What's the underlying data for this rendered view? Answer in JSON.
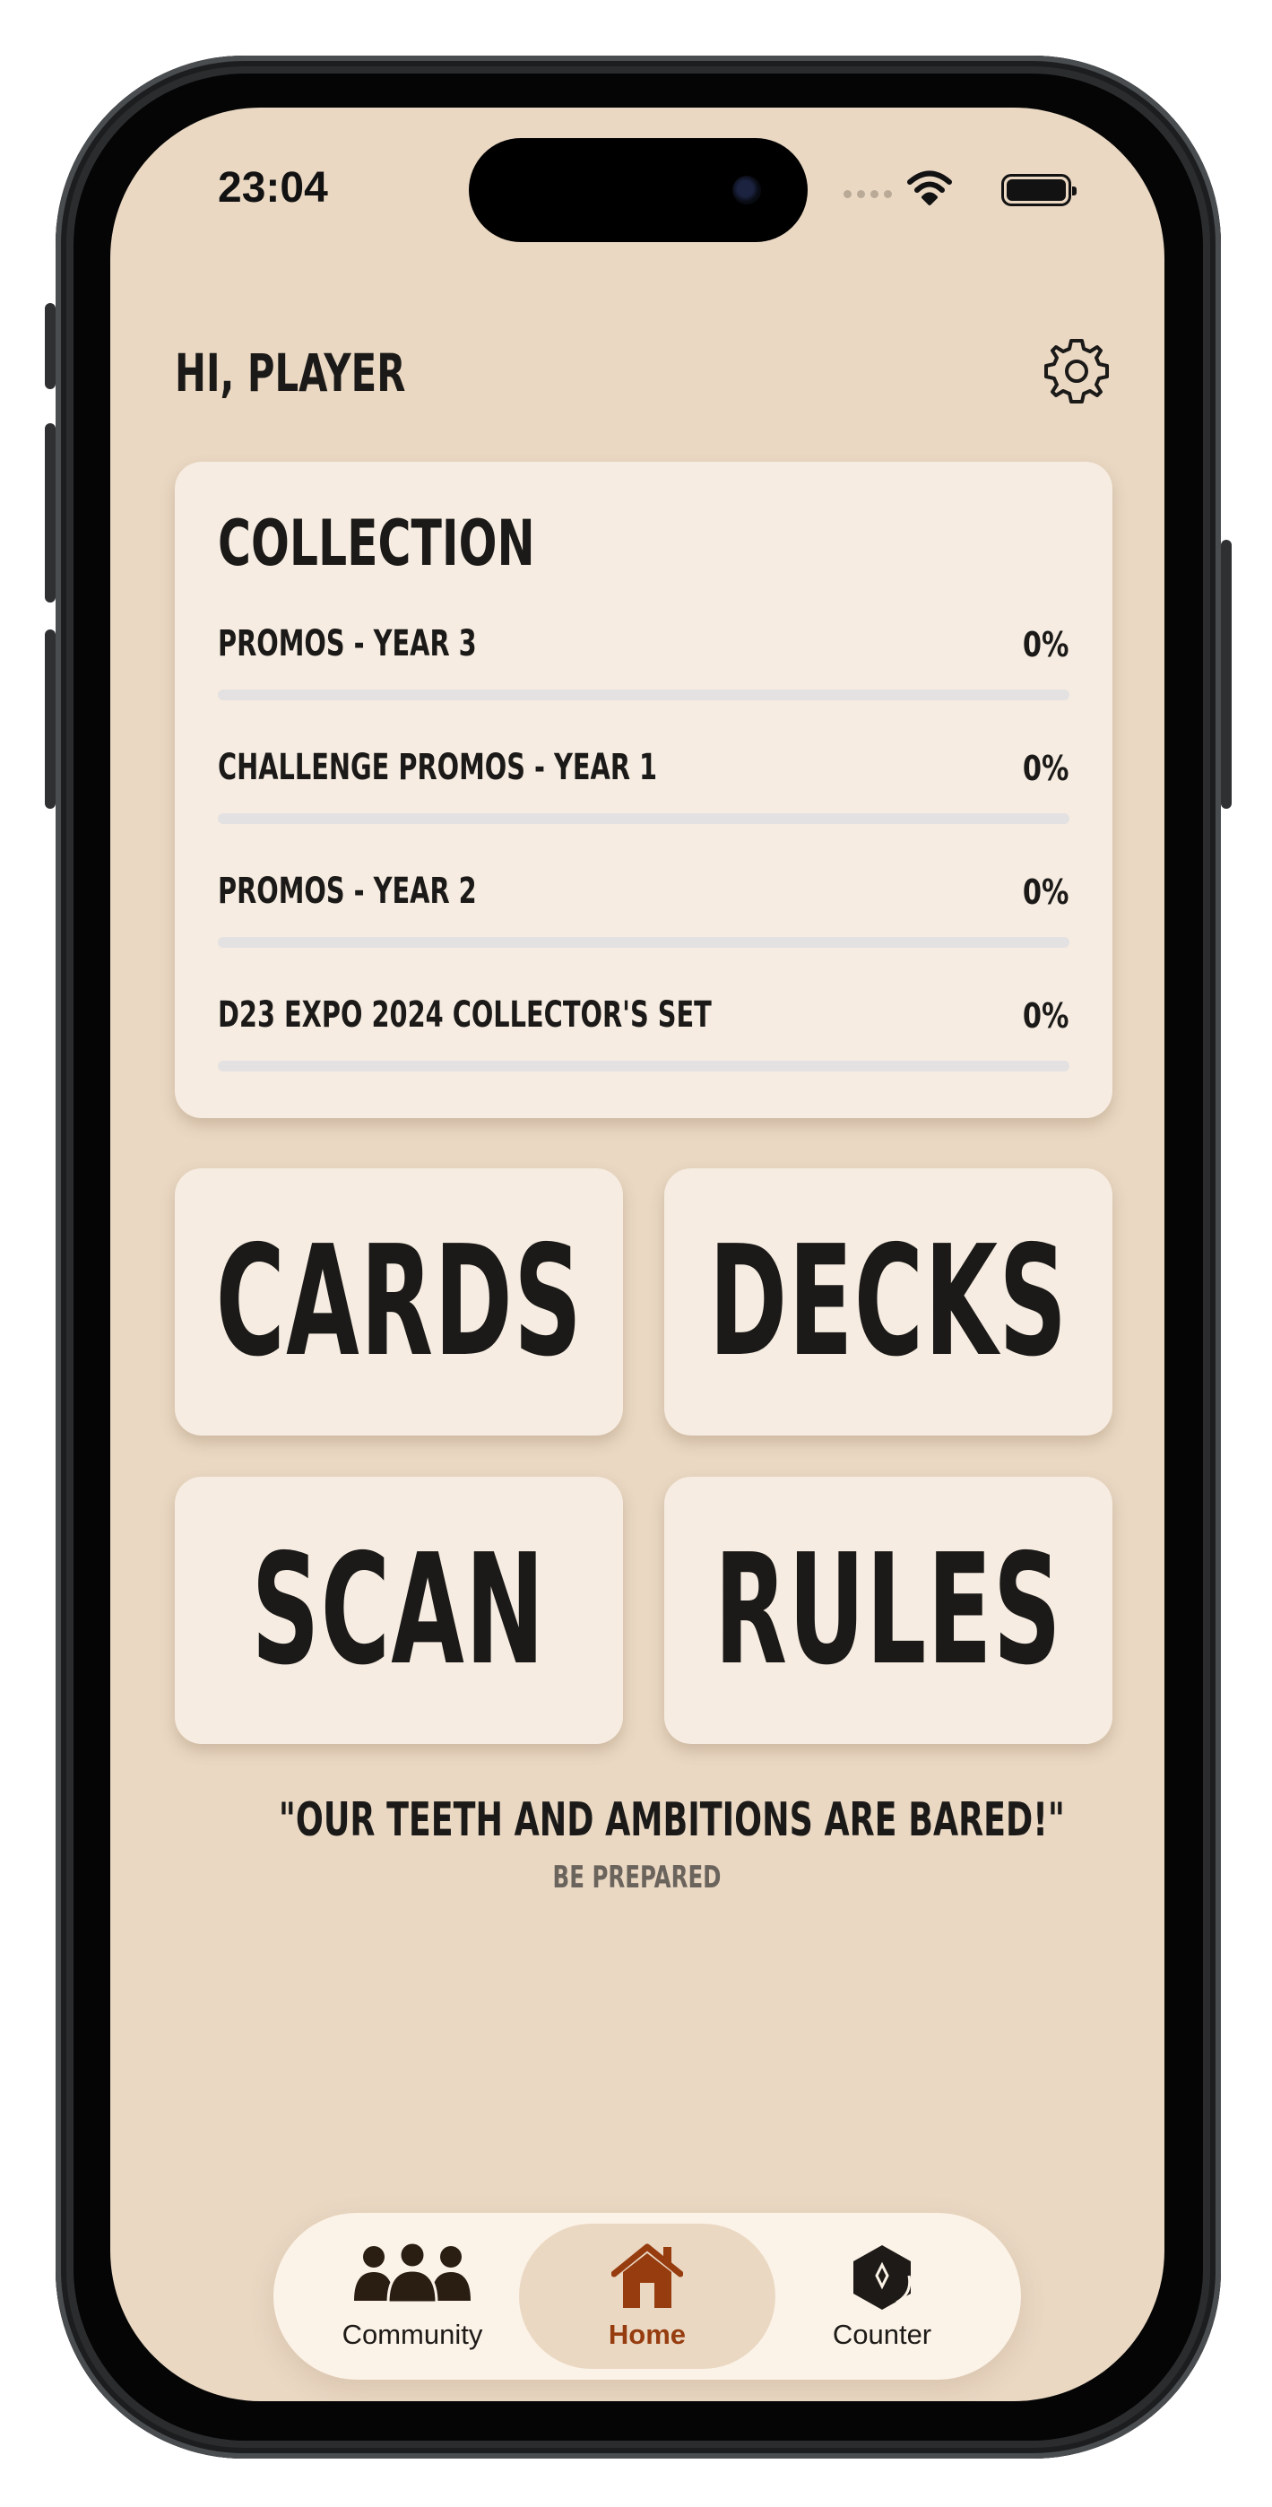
{
  "status_bar": {
    "time": "23:04"
  },
  "header": {
    "greeting": "HI, PLAYER",
    "settings_icon": "gear-icon"
  },
  "collection": {
    "title": "COLLECTION",
    "items": [
      {
        "name": "PROMOS - YEAR 3",
        "percent_label": "0%",
        "progress": 0
      },
      {
        "name": "CHALLENGE PROMOS - YEAR 1",
        "percent_label": "0%",
        "progress": 0
      },
      {
        "name": "PROMOS - YEAR 2",
        "percent_label": "0%",
        "progress": 0
      },
      {
        "name": "D23 EXPO 2024 COLLECTOR'S SET",
        "percent_label": "0%",
        "progress": 0
      }
    ]
  },
  "tiles": {
    "cards": "CARDS",
    "decks": "DECKS",
    "scan": "SCAN",
    "rules": "RULES"
  },
  "quote": {
    "text": "\"OUR TEETH AND AMBITIONS ARE BARED!\"",
    "subtitle": "BE PREPARED"
  },
  "tab_bar": {
    "tabs": [
      {
        "label": "Community",
        "icon": "people-icon",
        "active": false
      },
      {
        "label": "Home",
        "icon": "home-icon",
        "active": true
      },
      {
        "label": "Counter",
        "icon": "gem-icon",
        "active": false
      }
    ],
    "active_color": "#963c0f"
  },
  "colors": {
    "background": "#ead8c3",
    "card": "#f6ece1",
    "text": "#1b1a18",
    "accent": "#963c0f"
  }
}
